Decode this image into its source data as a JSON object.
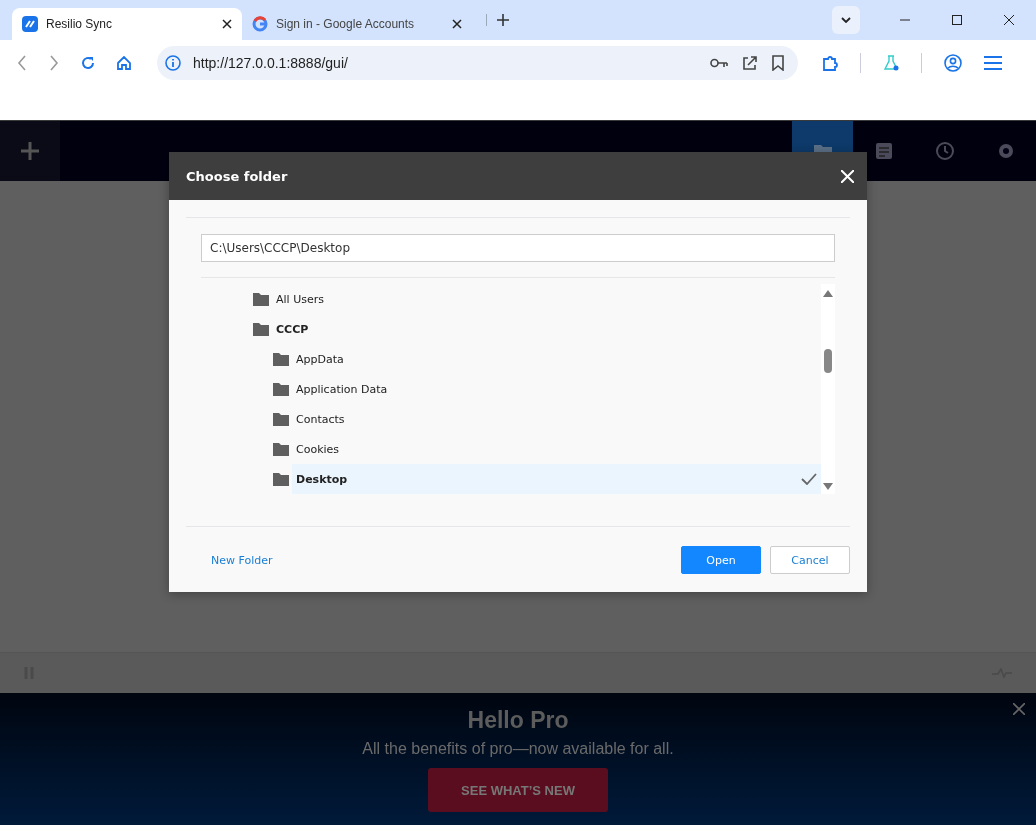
{
  "browser": {
    "tabs": [
      {
        "title": "Resilio Sync",
        "selected": true,
        "kind": "app"
      },
      {
        "title": "Sign in - Google Accounts",
        "selected": false,
        "kind": "google"
      }
    ],
    "address": "http://127.0.0.1:8888/gui/"
  },
  "app": {
    "nav": [
      {
        "kind": "folders",
        "selected": true
      },
      {
        "kind": "notes",
        "selected": false
      },
      {
        "kind": "history",
        "selected": false
      },
      {
        "kind": "settings",
        "selected": false
      }
    ]
  },
  "dialog": {
    "title": "Choose folder",
    "path": "C:\\Users\\CCCP\\Desktop",
    "tree": [
      {
        "name": "All Users",
        "selected": false,
        "expanded": false
      },
      {
        "name": "CCCP",
        "selected": false,
        "expanded": true,
        "children": [
          {
            "name": "AppData",
            "selected": false,
            "expanded": false
          },
          {
            "name": "Application Data",
            "selected": false,
            "expanded": false
          },
          {
            "name": "Contacts",
            "selected": false,
            "expanded": false
          },
          {
            "name": "Cookies",
            "selected": false,
            "expanded": false
          },
          {
            "name": "Desktop",
            "selected": true,
            "expanded": false
          }
        ]
      }
    ],
    "new_folder": "New Folder",
    "buttons": [
      {
        "label": "Open",
        "kind": "primary"
      },
      {
        "label": "Cancel",
        "kind": "secondary"
      }
    ]
  },
  "banner": {
    "title": "Hello Pro",
    "subtitle": "All the benefits of pro—now available for all.",
    "button": "SEE WHAT’S NEW"
  }
}
